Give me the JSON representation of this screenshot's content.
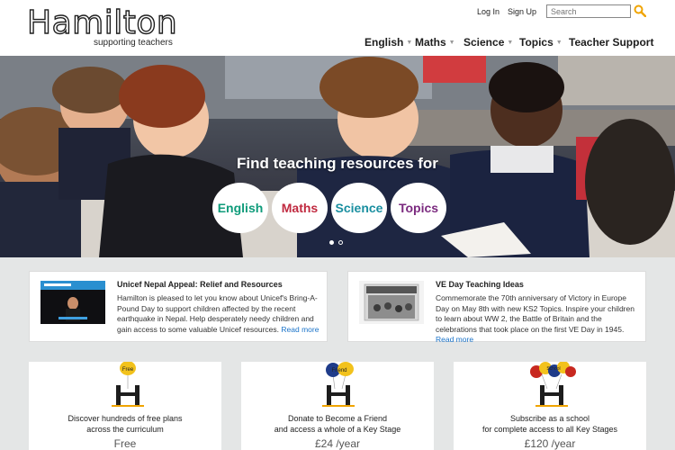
{
  "brand": {
    "name": "Hamilton",
    "tagline": "supporting teachers",
    "accent": "#f0a400"
  },
  "util_links": {
    "login": "Log In",
    "signup": "Sign Up"
  },
  "search": {
    "placeholder": "Search"
  },
  "nav": [
    {
      "label": "English",
      "has_menu": true
    },
    {
      "label": "Maths",
      "has_menu": true
    },
    {
      "label": "Science",
      "has_menu": true
    },
    {
      "label": "Topics",
      "has_menu": true
    },
    {
      "label": "Teacher Support",
      "has_menu": false
    }
  ],
  "hero": {
    "title": "Find teaching resources for",
    "subjects": [
      {
        "label": "English",
        "color": "#0e9b7a"
      },
      {
        "label": "Maths",
        "color": "#c0293f"
      },
      {
        "label": "Science",
        "color": "#1a8fa0"
      },
      {
        "label": "Topics",
        "color": "#7b2a7f"
      }
    ],
    "slide_count": 2,
    "active_slide": 1
  },
  "news": [
    {
      "title": "Unicef Nepal Appeal: Relief and Resources",
      "body": "Hamilton is pleased to let you know about Unicef's Bring-A-Pound Day to support children affected by the recent earthquake in Nepal. Help desperately needy children and gain access to some valuable Unicef resources.",
      "link": "Read more"
    },
    {
      "title": "VE Day Teaching Ideas",
      "body": "Commemorate the 70th anniversary of Victory in Europe Day on May 8th with new KS2 Topics. Inspire your children to learn about WW 2, the Battle of Britain and the celebrations that took place on the first VE Day in 1945.",
      "link": "Read more"
    }
  ],
  "plans": [
    {
      "line1": "Discover hundreds of free plans",
      "line2": "across the curriculum",
      "price": "Free",
      "balloon_text": "Free"
    },
    {
      "line1": "Donate to Become a Friend",
      "line2": "and access a whole of a Key Stage",
      "price": "£24 /year",
      "balloon_text": "Friend"
    },
    {
      "line1": "Subscribe as a school",
      "line2": "for complete access to all Key Stages",
      "price": "£120 /year",
      "balloon_text": "School"
    }
  ]
}
